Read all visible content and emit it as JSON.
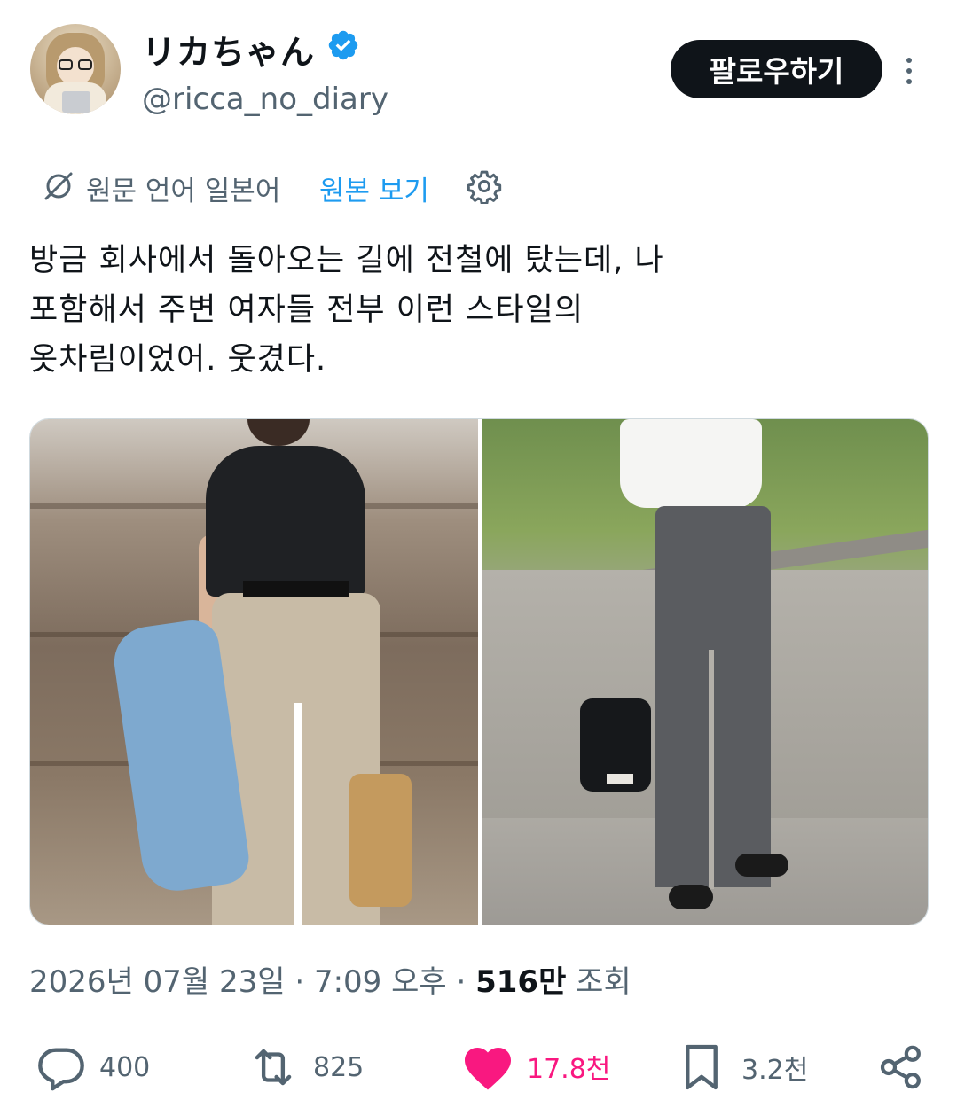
{
  "author": {
    "display_name": "リカちゃん",
    "handle": "@ricca_no_diary",
    "verified": true,
    "avatar_icon": "avatar-doll-with-laptop"
  },
  "header": {
    "follow_label": "팔로우하기",
    "more_icon": "more-vertical-icon"
  },
  "translation": {
    "source_language_text": "원문 언어 일본어",
    "show_original_label": "원본 보기",
    "translate_icon": "translate-icon",
    "settings_icon": "gear-icon"
  },
  "tweet": {
    "lines": [
      "방금 회사에서 돌아오는 길에 전철에 탔는데, 나",
      "포함해서 주변 여자들 전부 이런 스타일의",
      "옷차림이었어. 웃겼다."
    ]
  },
  "media": {
    "photos": [
      {
        "content": "woman in black t-shirt, beige pleated trousers, denim jacket, straw bag"
      },
      {
        "content": "woman in white t-shirt, gray wide trousers, black drawstring bag, sneakers"
      }
    ]
  },
  "meta": {
    "date": "2026년 07월 23일",
    "separator1": " · ",
    "time": "7:09 오후",
    "separator2": " · ",
    "views_value": "516만",
    "views_label": " 조회"
  },
  "actions": {
    "reply_count": "400",
    "retweet_count": "825",
    "like_count": "17.8천",
    "bookmark_count": "3.2천",
    "liked": true,
    "like_color": "#f91880",
    "accent_color": "#1d9bf0",
    "muted_color": "#536471"
  }
}
